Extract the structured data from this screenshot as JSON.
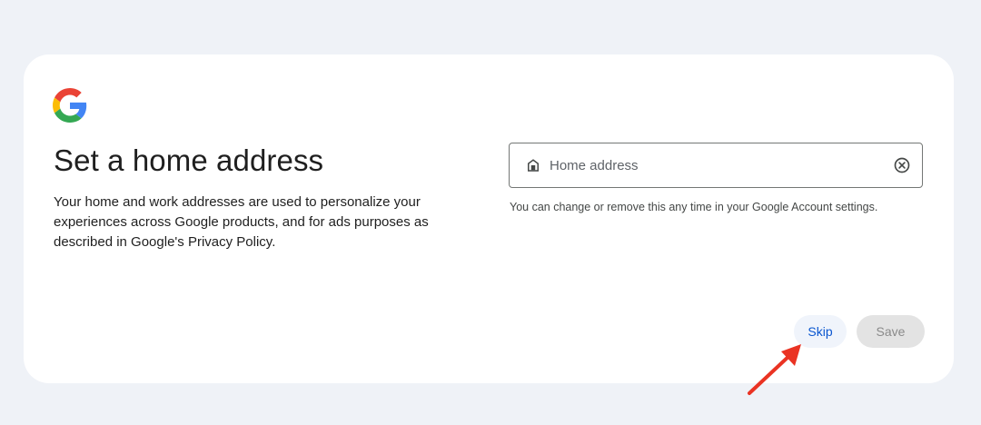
{
  "page": {
    "title": "Set a home address",
    "description": "Your home and work addresses are used to personalize your experiences across Google products, and for ads purposes as described in Google's Privacy Policy."
  },
  "address_field": {
    "value": "",
    "placeholder": "Home address",
    "leading_icon": "home-icon",
    "trailing_icon": "clear-icon"
  },
  "helper_text": "You can change or remove this any time in your Google Account settings.",
  "actions": {
    "skip_label": "Skip",
    "save_label": "Save"
  },
  "annotation": {
    "type": "arrow",
    "color": "#ea3323",
    "points_to": "Skip"
  },
  "colors": {
    "background": "#eff2f7",
    "card": "#ffffff",
    "text": "#1f1f1f",
    "skip_text": "#0b57d0",
    "skip_background": "#f0f4fb",
    "save_background": "#e3e3e3",
    "save_text": "#8a8a8a"
  }
}
